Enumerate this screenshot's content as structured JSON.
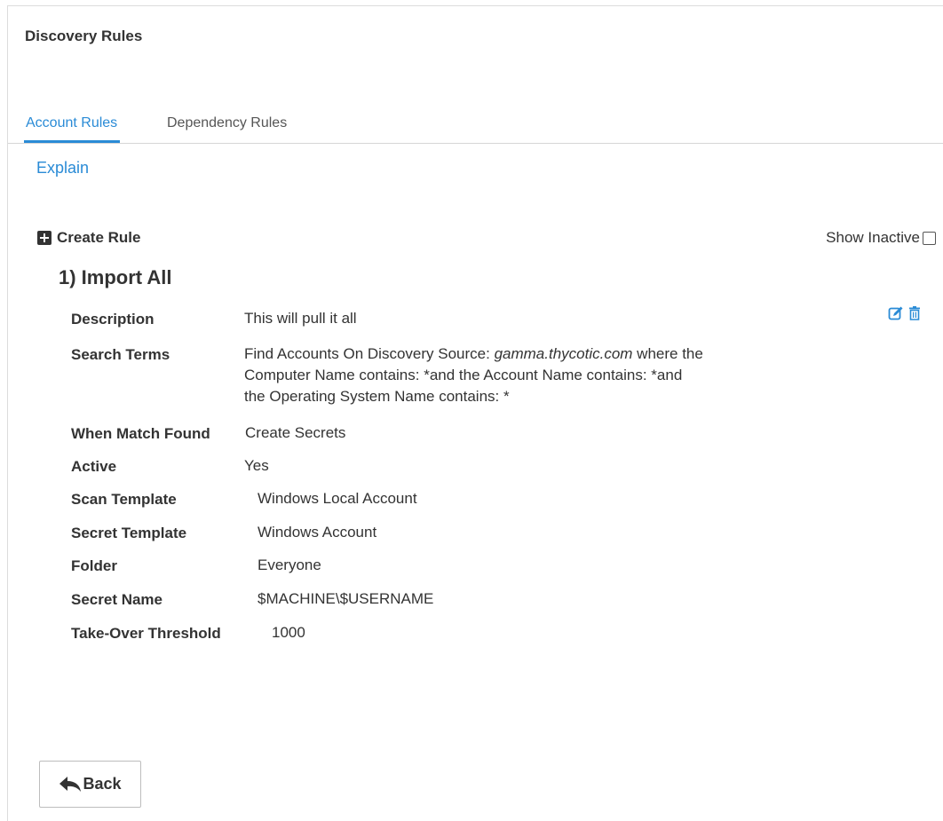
{
  "page": {
    "title": "Discovery Rules"
  },
  "tabs": [
    {
      "label": "Account Rules",
      "active": true
    },
    {
      "label": "Dependency Rules",
      "active": false
    }
  ],
  "explain_link": "Explain",
  "toolbar": {
    "create_rule": "Create Rule",
    "show_inactive": "Show Inactive",
    "show_inactive_checked": false
  },
  "rule": {
    "title": "1) Import All",
    "description_label": "Description",
    "description": "This will pull it all",
    "search_terms_label": "Search Terms",
    "search_terms": {
      "prefix": "Find Accounts On Discovery Source: ",
      "source": "gamma.thycotic.com",
      "line1_suffix": " where the",
      "line2": "Computer Name contains: *and the Account Name contains: *and",
      "line3": "the Operating System Name contains: *"
    },
    "when_match_label": "When Match Found",
    "when_match": "Create Secrets",
    "active_label": "Active",
    "active": "Yes",
    "scan_template_label": "Scan Template",
    "scan_template": "Windows Local Account",
    "secret_template_label": "Secret Template",
    "secret_template": "Windows Account",
    "folder_label": "Folder",
    "folder": "Everyone",
    "secret_name_label": "Secret Name",
    "secret_name": "$MACHINE\\$USERNAME",
    "takeover_label": "Take-Over Threshold",
    "takeover": "1000"
  },
  "back_button": "Back",
  "colors": {
    "link": "#2a8bd6",
    "text": "#333333",
    "border": "#d6d6d6"
  },
  "icons": [
    "plus-square-icon",
    "edit-icon",
    "trash-icon",
    "reply-arrow-icon"
  ]
}
